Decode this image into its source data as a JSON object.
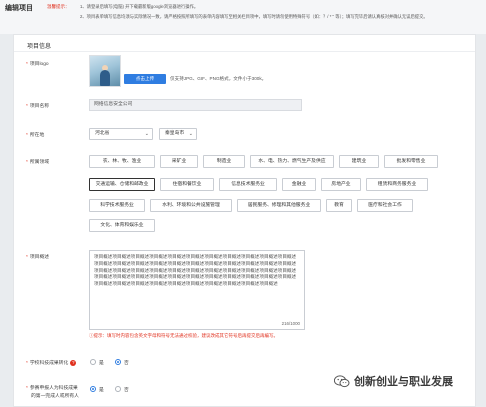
{
  "page": {
    "title": "编辑项目",
    "tip_label": "温馨提示：",
    "tips": [
      "1、请登录后填写(电脑)  开下载最新版google浏览器进行操作。",
      "2、项目表单填写信息均须与实际情况一致，请严格按照所填写的表单内容填写至相关栏目项中，填写时请勿使用特殊符号（如：？/ * \" 等）；填写完毕后请认真核对并确认无误后提交。"
    ]
  },
  "section": {
    "title": "项目信息"
  },
  "logo": {
    "label": "项目logo",
    "upload_button": "点击上传",
    "hint": "仅支持JPG、GIF、PNG格式，文件小于300k。"
  },
  "name": {
    "label": "项目名称",
    "value": "网络信息安全公司"
  },
  "location": {
    "label": "所在地",
    "province": "河北省",
    "city": "秦皇岛市"
  },
  "field": {
    "label": "所属领域",
    "options": [
      "农、林、牧、渔业",
      "采矿业",
      "制造业",
      "水、电、热力、燃气生产及供应",
      "建筑业",
      "批发和零售业",
      "交通运输、仓储和邮政业",
      "住宿和餐饮业",
      "信息技术服务业",
      "金融业",
      "房地产业",
      "租赁和商务服务业",
      "科学技术服务业",
      "水利、环境和公共设施管理",
      "居民服务、修理和其他服务业",
      "教育",
      "医疗和社会工作",
      "文化、体育和娱乐业"
    ]
  },
  "summary": {
    "label": "项目概述",
    "text": "项目概述项目概述项目概述项目概述项目概述项目概述项目概述项目概述项目概述项目概述项目概述项目概述项目概述项目概述项目概述项目概述项目概述项目概述项目概述项目概述项目概述项目概述项目概述项目概述项目概述项目概述项目概述项目概述项目概述项目概述项目概述项目概述项目概述项目概述项目概述项目概述项目概述项目概述项目概述项目概述项目概述项目概述项目概述项目概述项目概述项目概述项目概述项目概述项目概述项目概述项目概述项目概述项目概述项目概述",
    "count": "216/1000",
    "warning": "提示：填写时内容包含英文字母和符号无法通过校验，建议改成其它符号后再提交后再编写。"
  },
  "transfer": {
    "label": "学校科技成果转化",
    "opt_yes": "是",
    "opt_no": "否",
    "selected": "否"
  },
  "founder": {
    "label_line1": "参赛申报人为科技成果",
    "label_line2": "的第一完成人或所有人",
    "opt_yes": "是",
    "opt_no": "否",
    "selected": "是"
  },
  "watermark": {
    "text": "创新创业与职业发展"
  },
  "colors": {
    "accent": "#2f7de1",
    "required": "#e0301e"
  }
}
